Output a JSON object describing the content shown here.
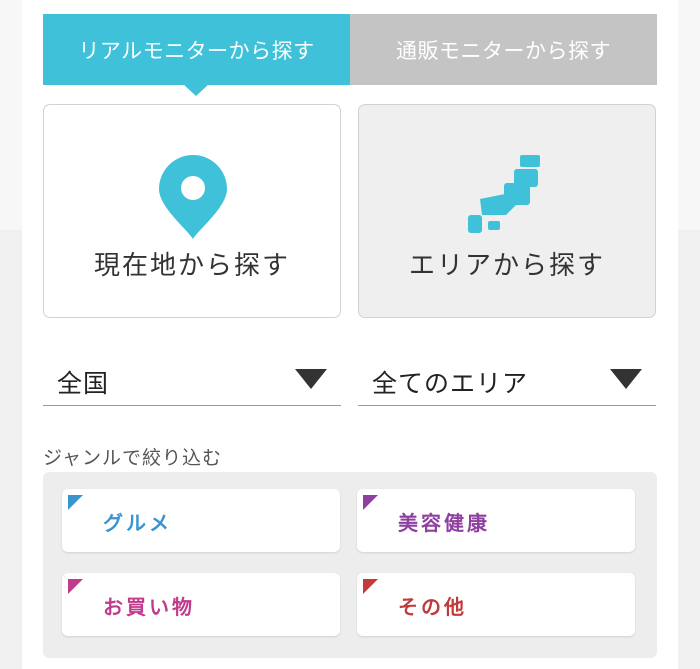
{
  "tabs": {
    "real": "リアルモニターから探す",
    "mail": "通販モニターから探す"
  },
  "search": {
    "current_location": "現在地から探す",
    "area": "エリアから探す"
  },
  "dropdowns": {
    "prefecture": "全国",
    "area": "全てのエリア"
  },
  "genre": {
    "title": "ジャンルで絞り込む",
    "items": [
      {
        "label": "グルメ",
        "color": "#3a94cf"
      },
      {
        "label": "美容健康",
        "color": "#8e3fa0"
      },
      {
        "label": "お買い物",
        "color": "#c03b8c"
      },
      {
        "label": "その他",
        "color": "#c23a3a"
      }
    ]
  },
  "colors": {
    "accent": "#3ec1d9",
    "inactive_tab": "#c4c4c4"
  }
}
